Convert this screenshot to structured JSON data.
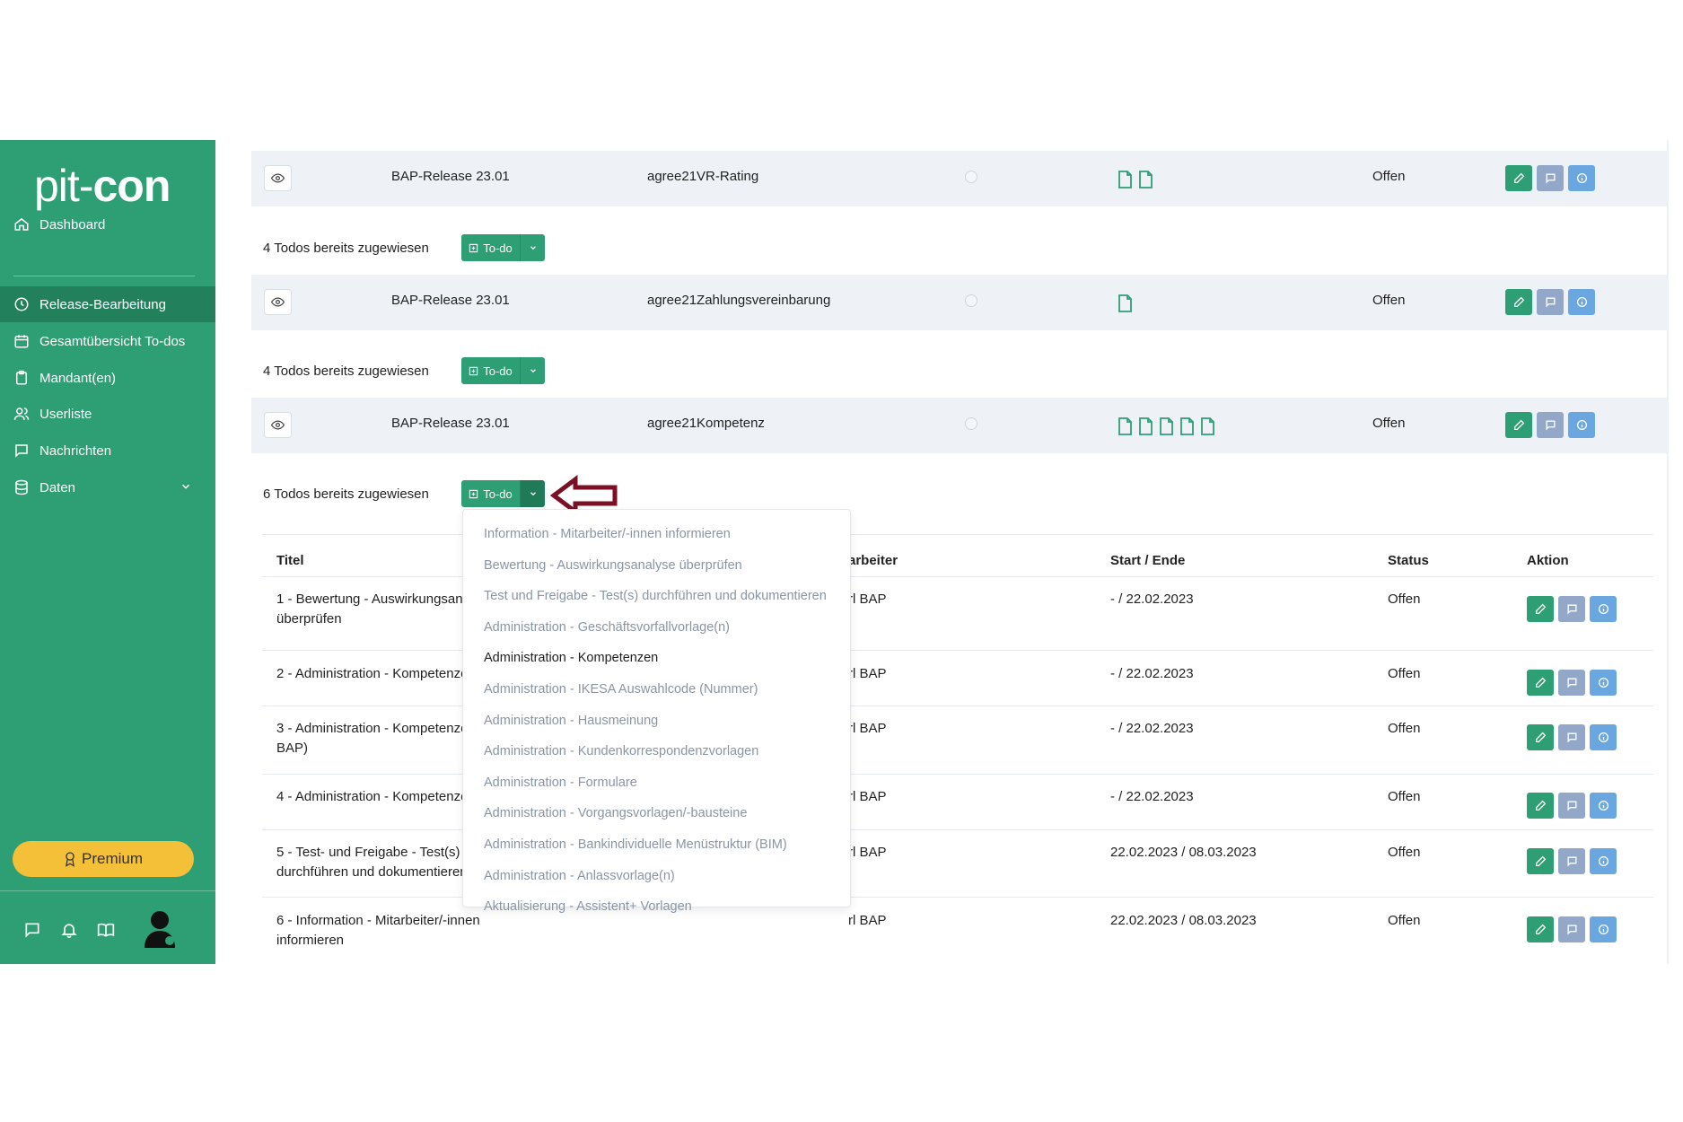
{
  "app": {
    "logo_part1": "pit-",
    "logo_part2": "con"
  },
  "sidebar": {
    "items": [
      {
        "label": "Dashboard",
        "icon": "home-icon"
      },
      {
        "label": "Release-Bearbeitung",
        "icon": "clock-icon",
        "active": true
      },
      {
        "label": "Gesamtübersicht To-dos",
        "icon": "calendar-icon"
      },
      {
        "label": "Mandant(en)",
        "icon": "clipboard-icon"
      },
      {
        "label": "Userliste",
        "icon": "users-icon"
      },
      {
        "label": "Nachrichten",
        "icon": "message-icon"
      },
      {
        "label": "Daten",
        "icon": "database-icon"
      }
    ],
    "premium_label": "Premium",
    "bottom_icons": [
      "message-icon",
      "bell-icon",
      "book-icon",
      "avatar"
    ]
  },
  "releases": [
    {
      "release": "BAP-Release 23.01",
      "name": "agree21VR-Rating",
      "documents": 2,
      "status": "Offen",
      "assigned": "4 Todos bereits zugewiesen"
    },
    {
      "release": "BAP-Release 23.01",
      "name": "agree21Zahlungsvereinbarung",
      "documents": 1,
      "status": "Offen",
      "assigned": "4 Todos bereits zugewiesen"
    },
    {
      "release": "BAP-Release 23.01",
      "name": "agree21Kompetenz",
      "documents": 5,
      "status": "Offen",
      "assigned": "6 Todos bereits zugewiesen"
    }
  ],
  "todo_button_label": "To-do",
  "table": {
    "headers": {
      "title": "Titel",
      "worker": "arbeiter",
      "dates": "Start / Ende",
      "status": "Status",
      "action": "Aktion"
    },
    "rows": [
      {
        "title_line1": "1 - Bewertung - Auswirkungsana",
        "title_line2": "überprüfen",
        "worker": "rl BAP",
        "dates": "- / 22.02.2023",
        "status": "Offen"
      },
      {
        "title_line1": "2 - Administration - Kompetenze",
        "title_line2": "",
        "worker": "rl BAP",
        "dates": "- / 22.02.2023",
        "status": "Offen"
      },
      {
        "title_line1": "3 - Administration - Kompetenze",
        "title_line2": "BAP)",
        "worker": "rl BAP",
        "dates": "- / 22.02.2023",
        "status": "Offen"
      },
      {
        "title_line1": "4 - Administration - Kompetenze",
        "title_line2": "",
        "worker": "rl BAP",
        "dates": "- / 22.02.2023",
        "status": "Offen"
      },
      {
        "title_line1": "5 - Test- und Freigabe - Test(s)",
        "title_line2": "durchführen und dokumentieren",
        "worker": "rl BAP",
        "dates": "22.02.2023 / 08.03.2023",
        "status": "Offen"
      },
      {
        "title_line1": "6 - Information - Mitarbeiter/-innen",
        "title_line2": "informieren",
        "worker": "rl BAP",
        "dates": "22.02.2023 / 08.03.2023",
        "status": "Offen"
      }
    ]
  },
  "dropdown": {
    "selected_index": 4,
    "items": [
      "Information - Mitarbeiter/-innen informieren",
      "Bewertung - Auswirkungsanalyse überprüfen",
      "Test und Freigabe - Test(s) durchführen und dokumentieren",
      "Administration - Geschäftsvorfallvorlage(n)",
      "Administration - Kompetenzen",
      "Administration - IKESA Auswahlcode (Nummer)",
      "Administration - Hausmeinung",
      "Administration - Kundenkorrespondenzvorlagen",
      "Administration - Formulare",
      "Administration - Vorgangsvorlagen/-bausteine",
      "Administration - Bankindividuelle Menüstruktur (BIM)",
      "Administration - Anlassvorlage(n)",
      "Aktualisierung - Assistent+ Vorlagen"
    ]
  },
  "colors": {
    "brand": "#2e9e74",
    "brand_dark": "#23805d",
    "premium": "#f3c037",
    "arrow": "#7a0f25"
  }
}
